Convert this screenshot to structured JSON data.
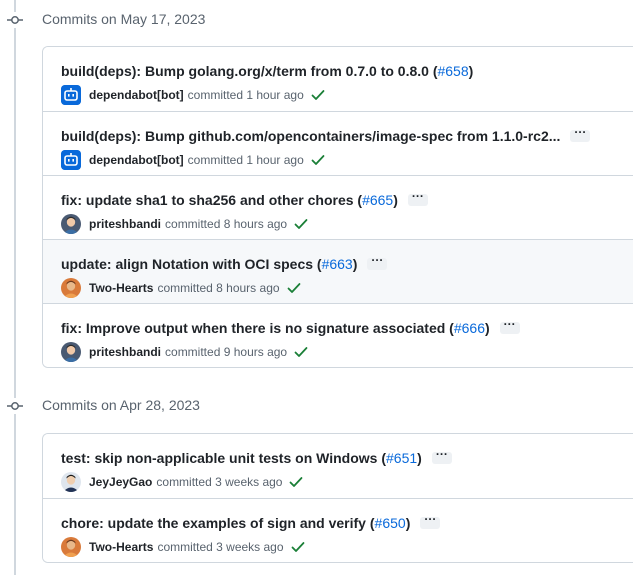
{
  "groups": [
    {
      "title": "Commits on May 17, 2023",
      "commits": [
        {
          "message": "build(deps): Bump golang.org/x/term from 0.7.0 to 0.8.0 (",
          "pr": "#658",
          "close": ")",
          "author": "dependabot[bot]",
          "action": "committed",
          "time": "1 hour ago",
          "avatar": "bot",
          "ellipsis": false
        },
        {
          "message": "build(deps): Bump github.com/opencontainers/image-spec from 1.1.0-rc2...",
          "pr": "",
          "close": "",
          "author": "dependabot[bot]",
          "action": "committed",
          "time": "1 hour ago",
          "avatar": "bot",
          "ellipsis": true
        },
        {
          "message": "fix: update sha1 to sha256 and other chores (",
          "pr": "#665",
          "close": ")",
          "author": "priteshbandi",
          "action": "committed",
          "time": "8 hours ago",
          "avatar": "person-a",
          "ellipsis": true
        },
        {
          "message": "update: align Notation with OCI specs (",
          "pr": "#663",
          "close": ")",
          "author": "Two-Hearts",
          "action": "committed",
          "time": "8 hours ago",
          "avatar": "person-b",
          "ellipsis": true,
          "hover": true
        },
        {
          "message": "fix: Improve output when there is no signature associated (",
          "pr": "#666",
          "close": ")",
          "author": "priteshbandi",
          "action": "committed",
          "time": "9 hours ago",
          "avatar": "person-a",
          "ellipsis": true
        }
      ]
    },
    {
      "title": "Commits on Apr 28, 2023",
      "commits": [
        {
          "message": "test: skip non-applicable unit tests on Windows (",
          "pr": "#651",
          "close": ")",
          "author": "JeyJeyGao",
          "action": "committed",
          "time": "3 weeks ago",
          "avatar": "person-c",
          "ellipsis": true
        },
        {
          "message": "chore: update the examples of sign and verify (",
          "pr": "#650",
          "close": ")",
          "author": "Two-Hearts",
          "action": "committed",
          "time": "3 weeks ago",
          "avatar": "person-b",
          "ellipsis": true
        }
      ]
    }
  ],
  "colors": {
    "link": "#0969da",
    "success": "#1a7f37",
    "border": "#d0d7de",
    "muted": "#59636e"
  },
  "icons": {
    "node": "git-commit-icon",
    "status": "check-icon",
    "more": "kebab-horizontal-icon"
  }
}
